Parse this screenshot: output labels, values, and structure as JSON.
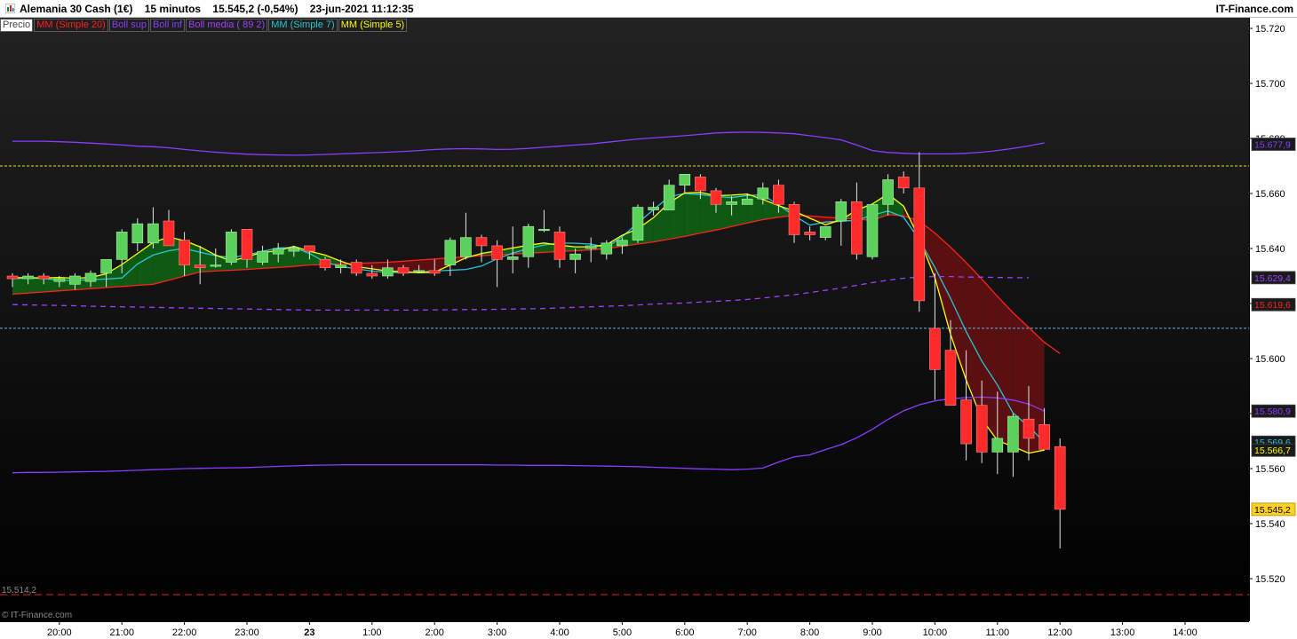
{
  "title_bar": {
    "text": "Alemania 30 Cash (1€)    15 minutos    15.545,2 (-0,54%)    23-jun-2021 11:12:35",
    "brand": "IT-Finance.com"
  },
  "legend": [
    {
      "label": "Precio",
      "color": "#444444"
    },
    {
      "label": "MM (Simple 20)",
      "color": "#ff2020"
    },
    {
      "label": "Boll sup",
      "color": "#8a3cff"
    },
    {
      "label": "Boll inf",
      "color": "#8a3cff"
    },
    {
      "label": "Boll media ( 89 2)",
      "color": "#a040ff"
    },
    {
      "label": "MM (Simple 7)",
      "color": "#26c6da"
    },
    {
      "label": "MM (Simple 5)",
      "color": "#ffff00"
    }
  ],
  "overlay": {
    "low_label": "15.514,2",
    "copyright": "© IT-Finance.com"
  },
  "chart_data": {
    "type": "candlestick",
    "title": "Alemania 30 Cash (1€) 15 minutos",
    "ylim": [
      15512,
      15726
    ],
    "y_ticks": [
      15720,
      15700,
      15680,
      15660,
      15640,
      15620,
      15600,
      15580,
      15560,
      15540,
      15520
    ],
    "y_tick_labels": [
      "15.720",
      "15.700",
      "15.680",
      "15.660",
      "15.640",
      "15.620",
      "15.600",
      "15.580",
      "15.560",
      "15.540",
      "15.520"
    ],
    "x_ticks": [
      {
        "label": "20:00",
        "bar": 3
      },
      {
        "label": "21:00",
        "bar": 7
      },
      {
        "label": "22:00",
        "bar": 11
      },
      {
        "label": "23:00",
        "bar": 15
      },
      {
        "label": "23",
        "bar": 19,
        "bold": true
      },
      {
        "label": "1:00",
        "bar": 23
      },
      {
        "label": "2:00",
        "bar": 27
      },
      {
        "label": "3:00",
        "bar": 31
      },
      {
        "label": "4:00",
        "bar": 35
      },
      {
        "label": "5:00",
        "bar": 39
      },
      {
        "label": "6:00",
        "bar": 43
      },
      {
        "label": "7:00",
        "bar": 47
      },
      {
        "label": "8:00",
        "bar": 51
      },
      {
        "label": "9:00",
        "bar": 55
      },
      {
        "label": "10:00",
        "bar": 59
      },
      {
        "label": "11:00",
        "bar": 63
      },
      {
        "label": "12:00",
        "bar": 67
      },
      {
        "label": "13:00",
        "bar": 71
      },
      {
        "label": "14:00",
        "bar": 75
      }
    ],
    "candles": [
      {
        "o": 15630,
        "h": 15631,
        "l": 15626,
        "c": 15629
      },
      {
        "o": 15629,
        "h": 15631,
        "l": 15627,
        "c": 15630
      },
      {
        "o": 15630,
        "h": 15631,
        "l": 15627,
        "c": 15629
      },
      {
        "o": 15628,
        "h": 15630,
        "l": 15626,
        "c": 15629
      },
      {
        "o": 15627,
        "h": 15631,
        "l": 15625,
        "c": 15630
      },
      {
        "o": 15628,
        "h": 15632,
        "l": 15626,
        "c": 15631
      },
      {
        "o": 15631,
        "h": 15636,
        "l": 15626,
        "c": 15636
      },
      {
        "o": 15636,
        "h": 15647,
        "l": 15631,
        "c": 15646
      },
      {
        "o": 15642,
        "h": 15651,
        "l": 15639,
        "c": 15649
      },
      {
        "o": 15642,
        "h": 15655,
        "l": 15640,
        "c": 15649
      },
      {
        "o": 15650,
        "h": 15654,
        "l": 15642,
        "c": 15641
      },
      {
        "o": 15643,
        "h": 15646,
        "l": 15630,
        "c": 15634
      },
      {
        "o": 15634,
        "h": 15641,
        "l": 15627,
        "c": 15633
      },
      {
        "o": 15634,
        "h": 15640,
        "l": 15633,
        "c": 15634
      },
      {
        "o": 15635,
        "h": 15647,
        "l": 15634,
        "c": 15646
      },
      {
        "o": 15647,
        "h": 15647,
        "l": 15633,
        "c": 15636
      },
      {
        "o": 15635,
        "h": 15641,
        "l": 15634,
        "c": 15639
      },
      {
        "o": 15638,
        "h": 15642,
        "l": 15635,
        "c": 15640
      },
      {
        "o": 15639,
        "h": 15641,
        "l": 15637,
        "c": 15640
      },
      {
        "o": 15641,
        "h": 15641,
        "l": 15636,
        "c": 15639
      },
      {
        "o": 15636,
        "h": 15637,
        "l": 15632,
        "c": 15633
      },
      {
        "o": 15633,
        "h": 15636,
        "l": 15631,
        "c": 15634
      },
      {
        "o": 15635,
        "h": 15636,
        "l": 15630,
        "c": 15631
      },
      {
        "o": 15631,
        "h": 15634,
        "l": 15629,
        "c": 15630
      },
      {
        "o": 15630,
        "h": 15636,
        "l": 15629,
        "c": 15633
      },
      {
        "o": 15633,
        "h": 15634,
        "l": 15630,
        "c": 15631
      },
      {
        "o": 15632,
        "h": 15634,
        "l": 15631,
        "c": 15632
      },
      {
        "o": 15632,
        "h": 15636,
        "l": 15630,
        "c": 15631
      },
      {
        "o": 15634,
        "h": 15644,
        "l": 15630,
        "c": 15643
      },
      {
        "o": 15637,
        "h": 15653,
        "l": 15636,
        "c": 15644
      },
      {
        "o": 15644,
        "h": 15645,
        "l": 15635,
        "c": 15641
      },
      {
        "o": 15641,
        "h": 15643,
        "l": 15626,
        "c": 15636
      },
      {
        "o": 15636,
        "h": 15648,
        "l": 15631,
        "c": 15637
      },
      {
        "o": 15637,
        "h": 15649,
        "l": 15633,
        "c": 15648
      },
      {
        "o": 15647,
        "h": 15654,
        "l": 15646,
        "c": 15647
      },
      {
        "o": 15646,
        "h": 15648,
        "l": 15633,
        "c": 15636
      },
      {
        "o": 15636,
        "h": 15640,
        "l": 15631,
        "c": 15638
      },
      {
        "o": 15640,
        "h": 15644,
        "l": 15635,
        "c": 15641
      },
      {
        "o": 15638,
        "h": 15643,
        "l": 15636,
        "c": 15642
      },
      {
        "o": 15641,
        "h": 15644,
        "l": 15638,
        "c": 15643
      },
      {
        "o": 15643,
        "h": 15656,
        "l": 15642,
        "c": 15655
      },
      {
        "o": 15654,
        "h": 15657,
        "l": 15652,
        "c": 15655
      },
      {
        "o": 15654,
        "h": 15665,
        "l": 15654,
        "c": 15663
      },
      {
        "o": 15663,
        "h": 15667,
        "l": 15660,
        "c": 15667
      },
      {
        "o": 15666,
        "h": 15667,
        "l": 15658,
        "c": 15661
      },
      {
        "o": 15661,
        "h": 15662,
        "l": 15653,
        "c": 15656
      },
      {
        "o": 15656,
        "h": 15659,
        "l": 15652,
        "c": 15657
      },
      {
        "o": 15656,
        "h": 15660,
        "l": 15656,
        "c": 15658
      },
      {
        "o": 15658,
        "h": 15664,
        "l": 15656,
        "c": 15662
      },
      {
        "o": 15663,
        "h": 15665,
        "l": 15653,
        "c": 15656
      },
      {
        "o": 15656,
        "h": 15657,
        "l": 15642,
        "c": 15645
      },
      {
        "o": 15646,
        "h": 15648,
        "l": 15643,
        "c": 15645
      },
      {
        "o": 15644,
        "h": 15648,
        "l": 15643,
        "c": 15648
      },
      {
        "o": 15650,
        "h": 15658,
        "l": 15641,
        "c": 15657
      },
      {
        "o": 15657,
        "h": 15664,
        "l": 15636,
        "c": 15638
      },
      {
        "o": 15637,
        "h": 15656,
        "l": 15636,
        "c": 15656
      },
      {
        "o": 15656,
        "h": 15667,
        "l": 15652,
        "c": 15665
      },
      {
        "o": 15666,
        "h": 15668,
        "l": 15660,
        "c": 15662
      },
      {
        "o": 15662,
        "h": 15675,
        "l": 15617,
        "c": 15621
      },
      {
        "o": 15611,
        "h": 15631,
        "l": 15585,
        "c": 15596
      },
      {
        "o": 15603,
        "h": 15614,
        "l": 15584,
        "c": 15583
      },
      {
        "o": 15585,
        "h": 15603,
        "l": 15563,
        "c": 15569
      },
      {
        "o": 15583,
        "h": 15592,
        "l": 15562,
        "c": 15566
      },
      {
        "o": 15566,
        "h": 15588,
        "l": 15558,
        "c": 15571
      },
      {
        "o": 15566,
        "h": 15580,
        "l": 15557,
        "c": 15579
      },
      {
        "o": 15578,
        "h": 15590,
        "l": 15563,
        "c": 15571
      },
      {
        "o": 15576,
        "h": 15582,
        "l": 15567,
        "c": 15567
      },
      {
        "o": 15568,
        "h": 15571,
        "l": 15531,
        "c": 15545.2
      }
    ],
    "series": [
      {
        "name": "MM (Simple 20)",
        "color": "#ff2020",
        "values": [
          15623.4,
          15623.8,
          15624.2,
          15624.6,
          15625,
          15625.4,
          15625.8,
          15626.2,
          15626.6,
          15627,
          15628.5,
          15630,
          15631.5,
          15631.8,
          15632.1,
          15632.4,
          15632.8,
          15633.1,
          15633.5,
          15634,
          15634.2,
          15634.4,
          15634.6,
          15634.8,
          15635,
          15635.4,
          15635.8,
          15636.2,
          15636.6,
          15637,
          15637.4,
          15637.7,
          15638,
          15638.3,
          15638.6,
          15638.9,
          15639.2,
          15639.5,
          15640,
          15640.8,
          15641.6,
          15642.4,
          15643.4,
          15644.4,
          15645.6,
          15646.7,
          15648,
          15649.3,
          15650.5,
          15651.4,
          15652,
          15651.8,
          15651.4,
          15651,
          15650.7,
          15650.2,
          15652.3,
          15651.9,
          15650,
          15645.6,
          15640.5,
          15634.9,
          15628.9,
          15622.6,
          15616.6,
          15611.3,
          15605.9,
          15601.8
        ]
      },
      {
        "name": "MM (Simple 7)",
        "color": "#26c6da",
        "values": [
          15629,
          15629.3,
          15629.1,
          15628.5,
          15628.4,
          15628.7,
          15628.9,
          15629.3,
          15634.4,
          15637.6,
          15639.2,
          15640,
          15638.6,
          15637.4,
          15636.7,
          15637.6,
          15639,
          15640.2,
          15640.4,
          15638.2,
          15635.1,
          15633.5,
          15632.6,
          15631.8,
          15631.4,
          15631.2,
          15631.4,
          15631.8,
          15632.1,
          15632.4,
          15633.6,
          15636.3,
          15638.3,
          15640,
          15641.3,
          15642,
          15641.9,
          15641.6,
          15640.4,
          15644.3,
          15649.3,
          15654.1,
          15658.8,
          15660,
          15659.6,
          15658.9,
          15658.5,
          15659.3,
          15659.5,
          15655.8,
          15651.9,
          15648.5,
          15649.6,
          15649.9,
          15650.3,
          15652.1,
          15653.6,
          15651.4,
          15643.2,
          15633.1,
          15621.9,
          15609.8,
          15599.1,
          15590.4,
          15580.2,
          15575.3,
          15569.6
        ]
      },
      {
        "name": "MM (Simple 5)",
        "color": "#ffff00",
        "values": [
          15629.4,
          15629.4,
          15629.3,
          15629.5,
          15629.2,
          15629.5,
          15630.8,
          15634.2,
          15638.2,
          15642.2,
          15644.2,
          15642.8,
          15640.6,
          15637.6,
          15635.4,
          15637,
          15638.6,
          15639.2,
          15640.8,
          15639,
          15637.6,
          15635.4,
          15633.4,
          15632.6,
          15631.8,
          15631.6,
          15631.2,
          15631.4,
          15634,
          15636.6,
          15638.2,
          15639.2,
          15640.2,
          15641.2,
          15642,
          15641.2,
          15640.6,
          15640.6,
          15641.4,
          15644.8,
          15647.2,
          15651.2,
          15656.6,
          15660.2,
          15660.4,
          15659.2,
          15659.4,
          15659.8,
          15657.8,
          15655.6,
          15653.6,
          15651,
          15648.6,
          15650.4,
          15654,
          15656.2,
          15659.8,
          15655.4,
          15643.6,
          15629.4,
          15608.8,
          15592.2,
          15578,
          15570.2,
          15568,
          15565.6,
          15566.7
        ]
      },
      {
        "name": "Boll sup",
        "color": "#8a3cff",
        "values": [
          15679,
          15679,
          15679,
          15678.8,
          15678.6,
          15678.3,
          15678,
          15677.6,
          15677.2,
          15677,
          15676.6,
          15676,
          15675.5,
          15675,
          15674.6,
          15674.3,
          15674.1,
          15674,
          15673.9,
          15674,
          15674.2,
          15674.4,
          15674.6,
          15674.8,
          15675,
          15675.3,
          15675.6,
          15676,
          15676.2,
          15676.3,
          15676.2,
          15676,
          15676.1,
          15676.4,
          15676.8,
          15677.2,
          15677.6,
          15678,
          15678.6,
          15679.2,
          15679.8,
          15680.2,
          15680.6,
          15681,
          15681.5,
          15682,
          15682.2,
          15682.3,
          15682.2,
          15682,
          15681.7,
          15681,
          15680.3,
          15679.5,
          15677.6,
          15675.6,
          15674.9,
          15674.6,
          15674.4,
          15674.4,
          15674.4,
          15674.6,
          15675,
          15675.6,
          15676.4,
          15677.3,
          15678.4
        ]
      },
      {
        "name": "Boll inf",
        "color": "#8a3cff",
        "values": [
          15558.5,
          15558.6,
          15558.6,
          15558.7,
          15558.8,
          15558.9,
          15559,
          15559.2,
          15559.4,
          15559.6,
          15559.8,
          15560,
          15560.1,
          15560.2,
          15560.3,
          15560.4,
          15560.6,
          15560.8,
          15561,
          15561.2,
          15561.3,
          15561.4,
          15561.4,
          15561.4,
          15561.4,
          15561.4,
          15561.4,
          15561.4,
          15561.4,
          15561.4,
          15561.4,
          15561.3,
          15561.3,
          15561.2,
          15561.2,
          15561.2,
          15561.1,
          15561,
          15560.9,
          15560.8,
          15560.7,
          15560.5,
          15560.3,
          15560.1,
          15559.9,
          15559.8,
          15559.6,
          15559.8,
          15560.2,
          15562.4,
          15564.3,
          15565,
          15566.9,
          15568.7,
          15571.2,
          15574.3,
          15577.9,
          15581,
          15583.2,
          15584.6,
          15585.4,
          15585.8,
          15586,
          15585.7,
          15584.9,
          15583.5,
          15580.9
        ]
      },
      {
        "name": "Boll media ( 89 2)",
        "color": "#a040ff",
        "dashed": true,
        "values": [
          15619.6,
          15619.5,
          15619.4,
          15619.3,
          15619.2,
          15619,
          15618.9,
          15618.8,
          15618.7,
          15618.6,
          15618.5,
          15618.4,
          15618.3,
          15618.2,
          15618.1,
          15618,
          15617.9,
          15617.8,
          15617.7,
          15617.6,
          15617.6,
          15617.6,
          15617.6,
          15617.6,
          15617.6,
          15617.6,
          15617.6,
          15617.7,
          15617.7,
          15617.8,
          15617.8,
          15617.9,
          15618,
          15618.1,
          15618.2,
          15618.4,
          15618.6,
          15618.8,
          15619,
          15619.2,
          15619.5,
          15619.8,
          15620,
          15620.2,
          15620.5,
          15620.8,
          15621.1,
          15621.5,
          15622,
          15622.6,
          15623.2,
          15624,
          15624.8,
          15625.6,
          15626.6,
          15627.6,
          15628.5,
          15629.2,
          15629.6,
          15629.8,
          15629.8,
          15629.6,
          15629.6,
          15629.5,
          15629.4,
          15629.4
        ]
      }
    ],
    "horizontal_lines": [
      {
        "value": 15670,
        "color": "#e8e800",
        "style": "dashed"
      },
      {
        "value": 15611,
        "color": "#5fb6e6",
        "style": "dashed"
      },
      {
        "value": 15514.2,
        "color": "#e02020",
        "style": "dashed"
      }
    ],
    "price_labels": [
      {
        "text": "15.677,9",
        "bg": "#1a1a1a",
        "fg": "#8a3cff",
        "value": 15677.9
      },
      {
        "text": "15.629,4",
        "bg": "#1a1a1a",
        "fg": "#a040ff",
        "value": 15629.4
      },
      {
        "text": "15.619,6",
        "bg": "#1a1a1a",
        "fg": "#ff2020",
        "value": 15619.6
      },
      {
        "text": "15.580,9",
        "bg": "#1a1a1a",
        "fg": "#8a3cff",
        "value": 15580.9
      },
      {
        "text": "15.569,6",
        "bg": "#1a1a1a",
        "fg": "#26c6da",
        "value": 15569.6
      },
      {
        "text": "15.566,7",
        "bg": "#1a1a1a",
        "fg": "#ffff00",
        "value": 15566.7
      },
      {
        "text": "15.545,2",
        "bg": "#ffd21f",
        "fg": "#000000",
        "value": 15545.2
      }
    ],
    "colors": {
      "bull": "#5bd15b",
      "bear": "#ff2a2a",
      "wick": "#e6e6e6",
      "fill_bull": "#0e5a12",
      "fill_bear": "#5a1010"
    }
  }
}
